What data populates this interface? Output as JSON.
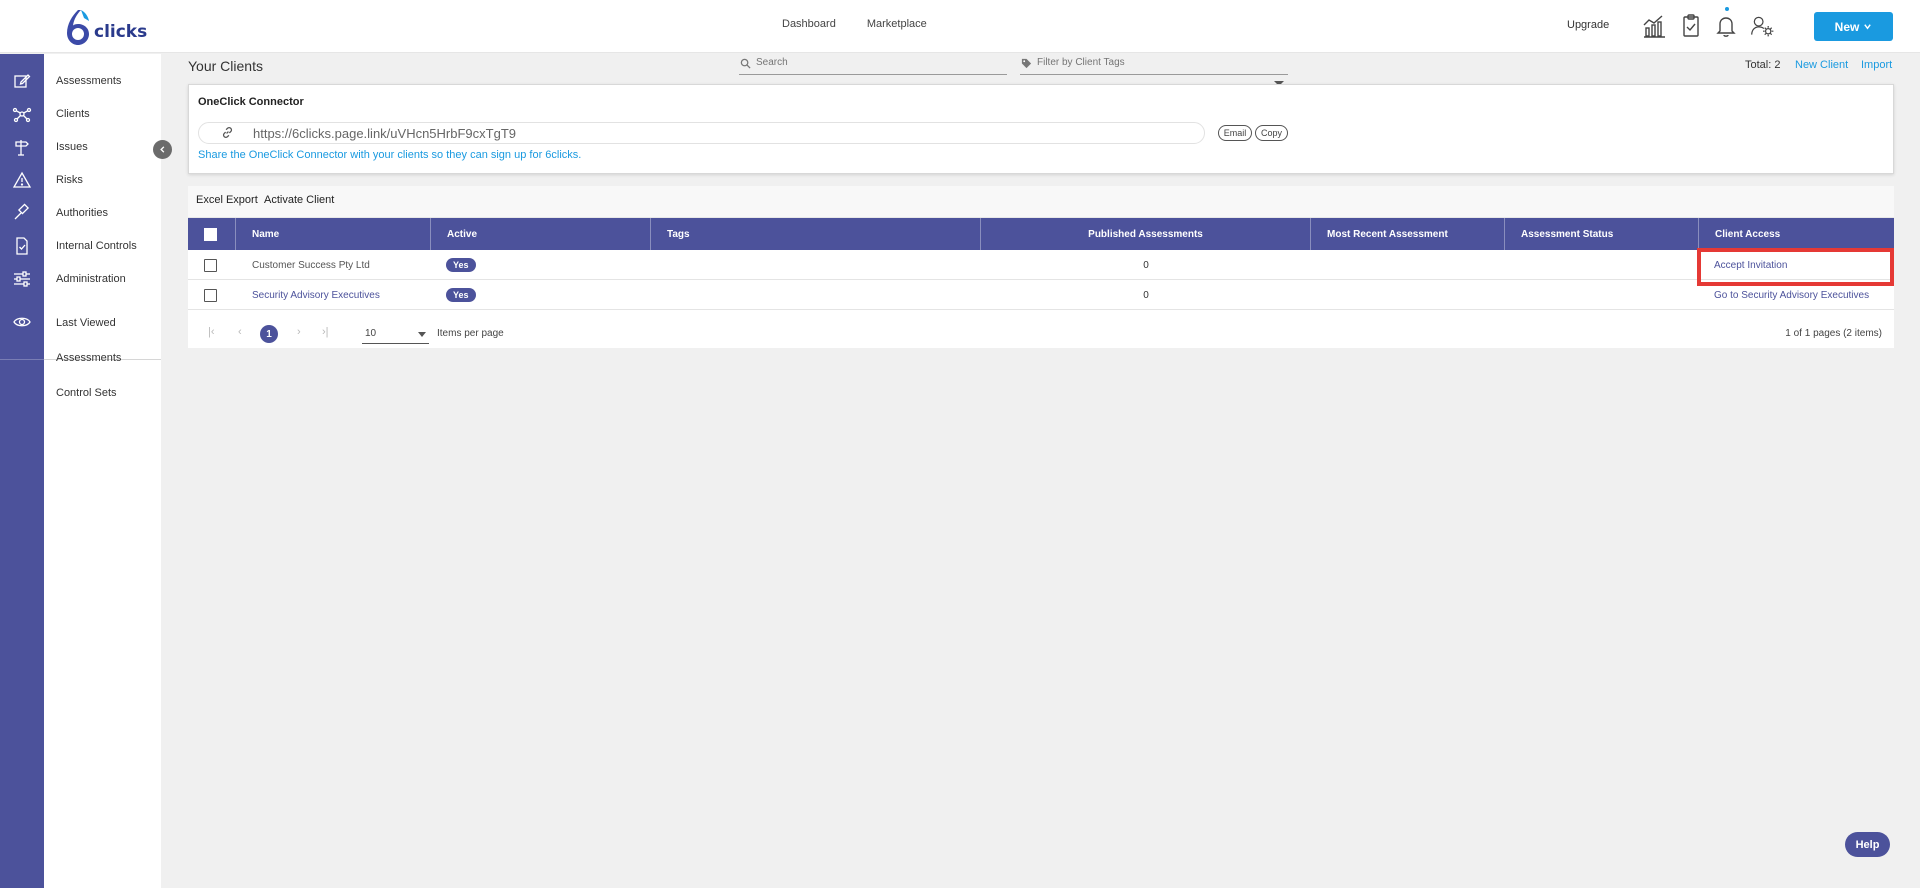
{
  "brand": {
    "logo_text": "clicks",
    "accent": "#1a9ae0",
    "primary": "#4c529b"
  },
  "topnav": {
    "dashboard": "Dashboard",
    "marketplace": "Marketplace"
  },
  "header": {
    "upgrade": "Upgrade",
    "new_label": "New",
    "icons": [
      "analytics-icon",
      "clipboard-check-icon",
      "bell-icon",
      "user-settings-icon"
    ]
  },
  "sidebar": {
    "items": [
      {
        "label": "Assessments",
        "icon": "edit-icon"
      },
      {
        "label": "Clients",
        "icon": "network-icon"
      },
      {
        "label": "Issues",
        "icon": "signpost-icon"
      },
      {
        "label": "Risks",
        "icon": "warning-icon"
      },
      {
        "label": "Authorities",
        "icon": "gavel-icon"
      },
      {
        "label": "Internal Controls",
        "icon": "document-check-icon"
      },
      {
        "label": "Administration",
        "icon": "sliders-icon"
      }
    ],
    "recent": {
      "label": "Last Viewed",
      "icon": "eye-icon",
      "items": [
        "Assessments",
        "Control Sets"
      ]
    }
  },
  "page": {
    "title": "Your Clients",
    "search_placeholder": "Search",
    "tag_filter_placeholder": "Filter by Client Tags",
    "total": "Total: 2",
    "new_client": "New Client",
    "import": "Import"
  },
  "connector": {
    "title": "OneClick Connector",
    "url": "https://6clicks.page.link/uVHcn5HrbF9cxTgT9",
    "email_label": "Email",
    "copy_label": "Copy",
    "note": "Share the OneClick Connector with your clients so they can sign up for 6clicks."
  },
  "toolbar": {
    "excel_export": "Excel Export",
    "activate_client": "Activate Client"
  },
  "table": {
    "columns": [
      "Name",
      "Active",
      "Tags",
      "Published Assessments",
      "Most Recent Assessment",
      "Assessment Status",
      "Client Access"
    ],
    "rows": [
      {
        "name": "Customer Success Pty Ltd",
        "active": "Yes",
        "tags": "",
        "published": "0",
        "recent": "",
        "status": "",
        "access": "Accept Invitation"
      },
      {
        "name": "Security Advisory Executives",
        "active": "Yes",
        "tags": "",
        "published": "0",
        "recent": "",
        "status": "",
        "access": "Go to Security Advisory Executives"
      }
    ]
  },
  "pagination": {
    "current_page": "1",
    "page_size": "10",
    "items_per_page": "Items per page",
    "info": "1 of 1 pages (2 items)"
  },
  "help": {
    "label": "Help"
  }
}
